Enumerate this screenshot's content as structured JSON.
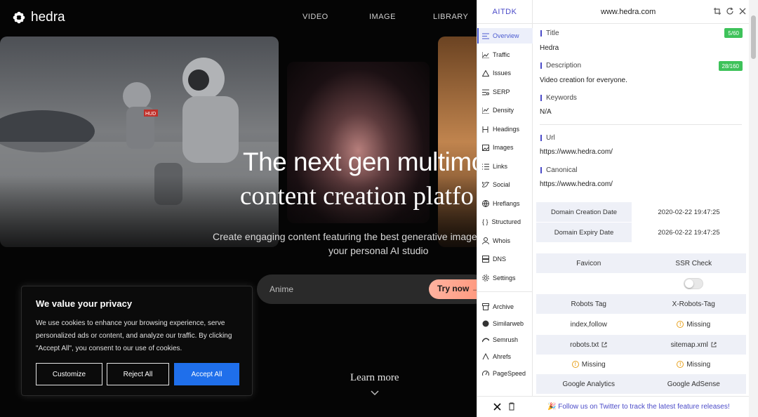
{
  "site": {
    "logo": "hedra",
    "nav": [
      "VIDEO",
      "IMAGE",
      "LIBRARY"
    ],
    "headline_1": "The next gen multimod",
    "headline_2": "content creation platfo",
    "subtitle_1": "Create engaging content featuring the best generative image, vide",
    "subtitle_2": "your personal AI studio",
    "prompt_value": "Anime",
    "try_label": "Try now",
    "learn_more": "Learn more",
    "card_badge": "HUD"
  },
  "cookie": {
    "title": "We value your privacy",
    "body": "We use cookies to enhance your browsing experience, serve personalized ads or content, and analyze our traffic. By clicking \"Accept All\", you consent to our use of cookies.",
    "customize": "Customize",
    "reject": "Reject All",
    "accept": "Accept All"
  },
  "panel": {
    "brand": "AITDK",
    "domain": "www.hedra.com",
    "sidebar": [
      "Overview",
      "Traffic",
      "Issues",
      "SERP",
      "Density",
      "Headings",
      "Images",
      "Links",
      "Social",
      "Hreflangs",
      "Structured",
      "Whois",
      "DNS",
      "Settings"
    ],
    "sidebar_tools": [
      "Archive",
      "Similarweb",
      "Semrush",
      "Ahrefs",
      "PageSpeed"
    ],
    "title_label": "Title",
    "title_value": "Hedra",
    "title_badge": "5/60",
    "desc_label": "Description",
    "desc_value": "Video creation for everyone.",
    "desc_badge": "28/160",
    "keywords_label": "Keywords",
    "keywords_value": "N/A",
    "url_label": "Url",
    "url_value": "https://www.hedra.com/",
    "canonical_label": "Canonical",
    "canonical_value": "https://www.hedra.com/",
    "creation_label": "Domain Creation Date",
    "creation_value": "2020-02-22 19:47:25",
    "expiry_label": "Domain Expiry Date",
    "expiry_value": "2026-02-22 19:47:25",
    "favicon": "Favicon",
    "ssr": "SSR Check",
    "robots_tag": "Robots Tag",
    "x_robots": "X-Robots-Tag",
    "robots_tag_value": "index,follow",
    "x_robots_value": "Missing",
    "robots_txt": "robots.txt",
    "sitemap": "sitemap.xml",
    "robots_txt_value": "Missing",
    "sitemap_value": "Missing",
    "ga": "Google Analytics",
    "adsense": "Google AdSense",
    "follow": "🎉 Follow us on Twitter to track the latest feature releases!",
    "accent": "#4b4bc8",
    "badge_color": "#3ec25a"
  }
}
